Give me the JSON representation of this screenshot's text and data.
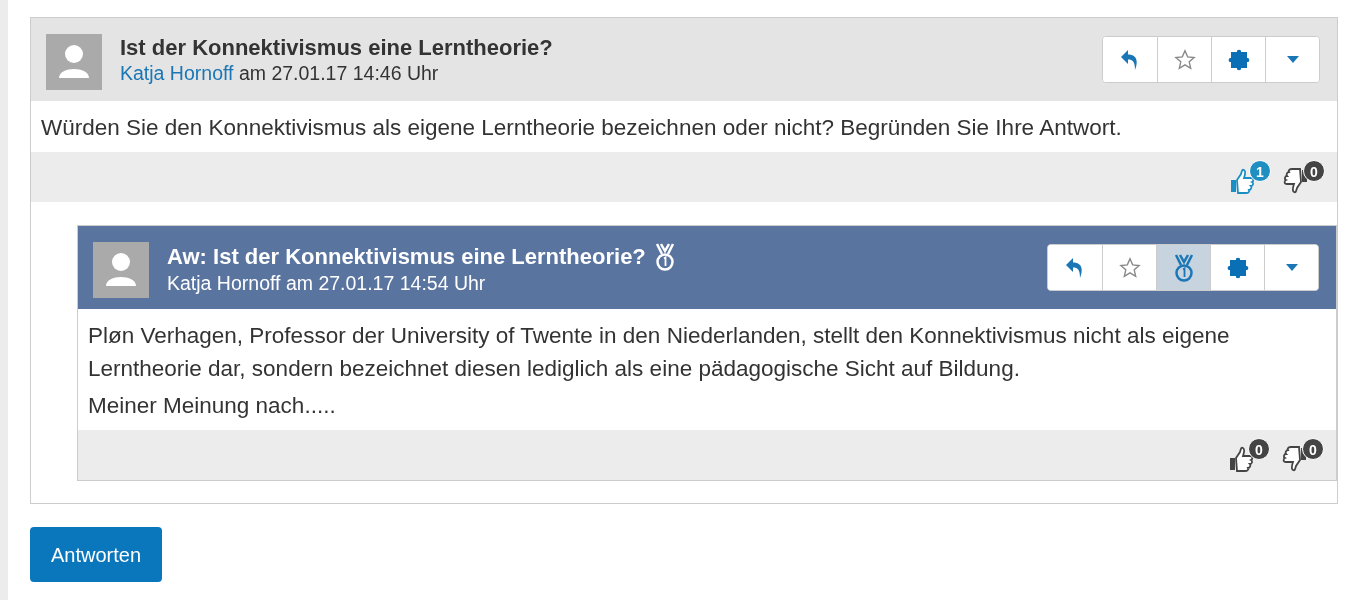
{
  "thread": {
    "title": "Ist der Konnektivismus eine Lerntheorie?",
    "author": "Katja Hornoff",
    "date": "am 27.01.17 14:46 Uhr",
    "highlighted": false,
    "buttons": [
      {
        "kind": "reply",
        "selected": false
      },
      {
        "kind": "favorite",
        "selected": false
      },
      {
        "kind": "tag",
        "selected": false
      },
      {
        "kind": "menu",
        "selected": false
      }
    ],
    "body": [
      "Würden Sie den Konnektivismus als eigene Lerntheorie bezeichnen oder nicht? Begründen Sie Ihre Antwort."
    ],
    "likes": {
      "count": "1",
      "selected": true
    },
    "dislikes": {
      "count": "0",
      "selected": false
    },
    "replies": [
      {
        "title": "Aw: Ist der Konnektivismus eine Lerntheorie?",
        "author": "Katja Hornoff",
        "date": "am 27.01.17 14:54 Uhr",
        "highlighted": true,
        "medal": true,
        "buttons": [
          {
            "kind": "reply",
            "selected": false
          },
          {
            "kind": "favorite",
            "selected": false
          },
          {
            "kind": "award",
            "selected": true
          },
          {
            "kind": "tag",
            "selected": false
          },
          {
            "kind": "menu",
            "selected": false
          }
        ],
        "body": [
          "Pløn Verhagen, Professor der University of Twente in den Niederlanden, stellt den Konnektivismus nicht als eigene Lerntheorie dar, sondern bezeichnet diesen lediglich als eine pädagogische Sicht auf Bildung.",
          "Meiner Meinung nach....."
        ],
        "likes": {
          "count": "0",
          "selected": false
        },
        "dislikes": {
          "count": "0",
          "selected": false
        }
      }
    ]
  },
  "reply_button": "Antworten"
}
